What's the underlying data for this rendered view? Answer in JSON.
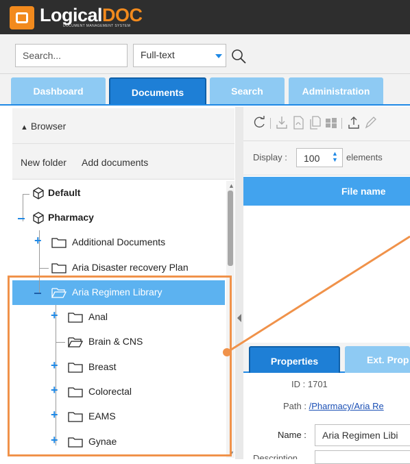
{
  "app": {
    "logo_main": "Logical",
    "logo_accent": "DOC",
    "logo_tagline": "DOCUMENT MANAGEMENT SYSTEM",
    "brand_color": "#f28a1d"
  },
  "search": {
    "placeholder": "Search...",
    "mode": "Full-text"
  },
  "tabs": [
    {
      "label": "Dashboard",
      "active": false
    },
    {
      "label": "Documents",
      "active": true
    },
    {
      "label": "Search",
      "active": false
    },
    {
      "label": "Administration",
      "active": false
    }
  ],
  "browser": {
    "title": "Browser",
    "new_folder": "New folder",
    "add_documents": "Add documents"
  },
  "tree": {
    "items": [
      {
        "label": "Default",
        "level": 0,
        "bold": true,
        "icon": "cube-icon"
      },
      {
        "label": "Pharmacy",
        "level": 0,
        "bold": true,
        "icon": "cube-icon",
        "expanded": true
      },
      {
        "label": "Additional Documents",
        "level": 1,
        "icon": "folder-icon",
        "expandable": true
      },
      {
        "label": "Aria Disaster recovery Plan",
        "level": 1,
        "icon": "folder-icon"
      },
      {
        "label": "Aria Regimen Library",
        "level": 1,
        "icon": "folder-open-icon",
        "selected": true,
        "expanded": true
      },
      {
        "label": "Anal",
        "level": 2,
        "icon": "folder-icon",
        "expandable": true
      },
      {
        "label": "Brain & CNS",
        "level": 2,
        "icon": "folder-open-icon"
      },
      {
        "label": "Breast",
        "level": 2,
        "icon": "folder-icon",
        "expandable": true
      },
      {
        "label": "Colorectal",
        "level": 2,
        "icon": "folder-icon",
        "expandable": true
      },
      {
        "label": "EAMS",
        "level": 2,
        "icon": "folder-icon",
        "expandable": true
      },
      {
        "label": "Gynae",
        "level": 2,
        "icon": "folder-icon",
        "expandable": true
      }
    ]
  },
  "documents": {
    "display_label": "Display :",
    "display_value": "100",
    "display_suffix": "elements",
    "column_file_name": "File name"
  },
  "details": {
    "tabs": [
      "Properties",
      "Ext. Prop"
    ],
    "id_label": "ID :",
    "id_value": "1701",
    "path_label": "Path :",
    "path_value": "/Pharmacy/Aria Re",
    "name_label": "Name :",
    "name_value": "Aria Regimen Libi",
    "description_label": "Description"
  },
  "colors": {
    "accent": "#1e88e5",
    "selection": "#5cb2f0",
    "highlight": "#f0924a"
  }
}
